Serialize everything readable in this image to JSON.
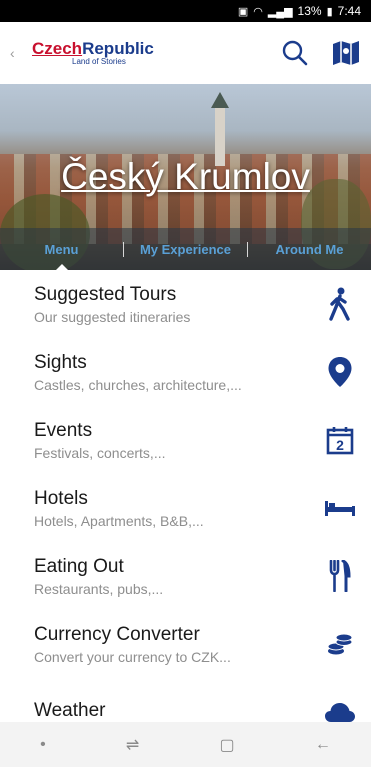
{
  "status_bar": {
    "battery": "13%",
    "time": "7:44"
  },
  "app_bar": {
    "logo_czech": "Czech",
    "logo_republic": "Republic",
    "logo_tagline": "Land of Stories"
  },
  "hero": {
    "title": "Český Krumlov",
    "tabs": [
      {
        "label": "Menu"
      },
      {
        "label": "My Experience"
      },
      {
        "label": "Around Me"
      }
    ]
  },
  "menu": [
    {
      "title": "Suggested Tours",
      "subtitle": "Our suggested itineraries",
      "icon": "walking-person-icon"
    },
    {
      "title": "Sights",
      "subtitle": "Castles, churches, architecture,...",
      "icon": "location-pin-icon"
    },
    {
      "title": "Events",
      "subtitle": "Festivals, concerts,...",
      "icon": "calendar-icon"
    },
    {
      "title": "Hotels",
      "subtitle": "Hotels, Apartments, B&B,...",
      "icon": "bed-icon"
    },
    {
      "title": "Eating Out",
      "subtitle": "Restaurants, pubs,...",
      "icon": "fork-knife-icon"
    },
    {
      "title": "Currency Converter",
      "subtitle": "Convert your currency to CZK...",
      "icon": "coins-icon"
    },
    {
      "title": "Weather",
      "subtitle": "",
      "icon": "cloud-icon"
    }
  ],
  "calendar_day": "2",
  "colors": {
    "accent": "#1b3c8c",
    "brand_red": "#c8102e",
    "tab_text": "#5aa0d6"
  }
}
